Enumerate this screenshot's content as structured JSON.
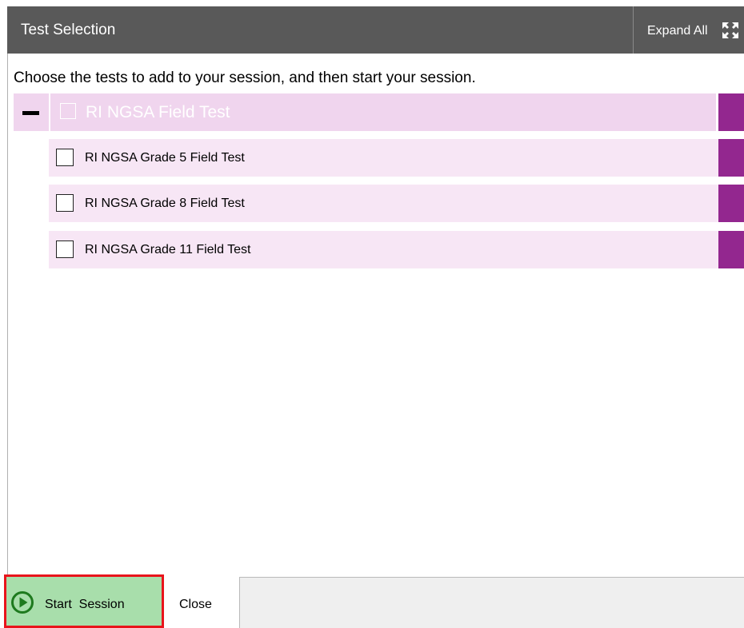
{
  "header": {
    "title": "Test Selection",
    "expand_all_label": "Expand All",
    "expand_icon": "expand-arrows-icon"
  },
  "instructions": "Choose the tests to add to your session, and then start your session.",
  "group": {
    "label": "RI NGSA Field Test",
    "expanded": true,
    "toggle_icon": "minus-icon",
    "checked": false
  },
  "tests": [
    {
      "label": "RI NGSA Grade 5 Field Test",
      "checked": false
    },
    {
      "label": "RI NGSA Grade 8 Field Test",
      "checked": false
    },
    {
      "label": "RI NGSA Grade 11 Field Test",
      "checked": false
    }
  ],
  "footer": {
    "start_label": "Start  Session",
    "start_icon": "play-circle-icon",
    "close_label": "Close"
  },
  "colors": {
    "header_bg": "#595959",
    "group_bg": "#f0d5ee",
    "test_bg": "#f7e6f5",
    "accent": "#93278f",
    "start_bg": "#a8deab",
    "start_icon": "#1e7a1e",
    "highlight": "#e8141b"
  }
}
